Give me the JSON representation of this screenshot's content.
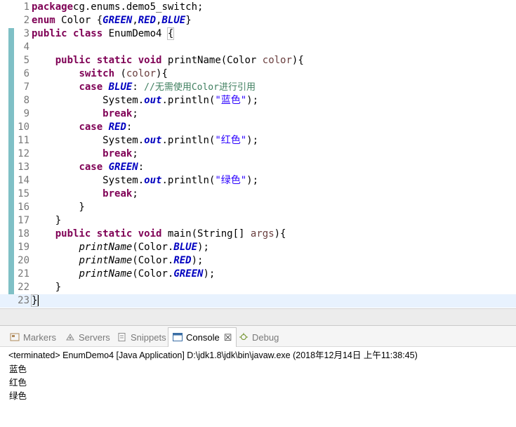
{
  "editor": {
    "lines": [
      {
        "n": "1",
        "segs": [
          [
            "kw",
            "package"
          ],
          [
            "",
            "cg.enums.demo5_switch;"
          ]
        ]
      },
      {
        "n": "2",
        "segs": [
          [
            "kw",
            "enum"
          ],
          [
            "",
            " Color {"
          ],
          [
            "en",
            "GREEN"
          ],
          [
            "",
            ","
          ],
          [
            "en",
            "RED"
          ],
          [
            "",
            ","
          ],
          [
            "en",
            "BLUE"
          ],
          [
            "",
            "}"
          ]
        ]
      },
      {
        "n": "3",
        "segs": [
          [
            "kw",
            "public"
          ],
          [
            "",
            " "
          ],
          [
            "kw",
            "class"
          ],
          [
            "",
            " EnumDemo4 "
          ],
          [
            "br",
            "{"
          ]
        ]
      },
      {
        "n": "4",
        "segs": []
      },
      {
        "n": "5",
        "segs": [
          [
            "",
            "    "
          ],
          [
            "kw",
            "public"
          ],
          [
            "",
            " "
          ],
          [
            "kw",
            "static"
          ],
          [
            "",
            " "
          ],
          [
            "kw",
            "void"
          ],
          [
            "",
            " printName(Color "
          ],
          [
            "param",
            "color"
          ],
          [
            "",
            "){"
          ]
        ]
      },
      {
        "n": "6",
        "segs": [
          [
            "",
            "        "
          ],
          [
            "kw",
            "switch"
          ],
          [
            "",
            " ("
          ],
          [
            "param",
            "color"
          ],
          [
            "",
            "){"
          ]
        ]
      },
      {
        "n": "7",
        "segs": [
          [
            "",
            "        "
          ],
          [
            "kw",
            "case"
          ],
          [
            "",
            " "
          ],
          [
            "en",
            "BLUE"
          ],
          [
            "",
            ": "
          ],
          [
            "cm",
            "//无需使用Color进行引用"
          ]
        ]
      },
      {
        "n": "8",
        "segs": [
          [
            "",
            "            System."
          ],
          [
            "fld",
            "out"
          ],
          [
            "",
            ".println("
          ],
          [
            "str",
            "\"蓝色\""
          ],
          [
            "",
            ");"
          ]
        ]
      },
      {
        "n": "9",
        "segs": [
          [
            "",
            "            "
          ],
          [
            "kw",
            "break"
          ],
          [
            "",
            ";"
          ]
        ]
      },
      {
        "n": "10",
        "segs": [
          [
            "",
            "        "
          ],
          [
            "kw",
            "case"
          ],
          [
            "",
            " "
          ],
          [
            "en",
            "RED"
          ],
          [
            "",
            ":"
          ]
        ]
      },
      {
        "n": "11",
        "segs": [
          [
            "",
            "            System."
          ],
          [
            "fld",
            "out"
          ],
          [
            "",
            ".println("
          ],
          [
            "str",
            "\"红色\""
          ],
          [
            "",
            ");"
          ]
        ]
      },
      {
        "n": "12",
        "segs": [
          [
            "",
            "            "
          ],
          [
            "kw",
            "break"
          ],
          [
            "",
            ";"
          ]
        ]
      },
      {
        "n": "13",
        "segs": [
          [
            "",
            "        "
          ],
          [
            "kw",
            "case"
          ],
          [
            "",
            " "
          ],
          [
            "en",
            "GREEN"
          ],
          [
            "",
            ":"
          ]
        ]
      },
      {
        "n": "14",
        "segs": [
          [
            "",
            "            System."
          ],
          [
            "fld",
            "out"
          ],
          [
            "",
            ".println("
          ],
          [
            "str",
            "\"绿色\""
          ],
          [
            "",
            ");"
          ]
        ]
      },
      {
        "n": "15",
        "segs": [
          [
            "",
            "            "
          ],
          [
            "kw",
            "break"
          ],
          [
            "",
            ";"
          ]
        ]
      },
      {
        "n": "16",
        "segs": [
          [
            "",
            "        }"
          ]
        ]
      },
      {
        "n": "17",
        "segs": [
          [
            "",
            "    }"
          ]
        ]
      },
      {
        "n": "18",
        "segs": [
          [
            "",
            "    "
          ],
          [
            "kw",
            "public"
          ],
          [
            "",
            " "
          ],
          [
            "kw",
            "static"
          ],
          [
            "",
            " "
          ],
          [
            "kw",
            "void"
          ],
          [
            "",
            " main(String[] "
          ],
          [
            "param",
            "args"
          ],
          [
            "",
            "){"
          ]
        ]
      },
      {
        "n": "19",
        "segs": [
          [
            "",
            "        "
          ],
          [
            "sm",
            "printName"
          ],
          [
            "",
            "(Color."
          ],
          [
            "en",
            "BLUE"
          ],
          [
            "",
            ");"
          ]
        ]
      },
      {
        "n": "20",
        "segs": [
          [
            "",
            "        "
          ],
          [
            "sm",
            "printName"
          ],
          [
            "",
            "(Color."
          ],
          [
            "en",
            "RED"
          ],
          [
            "",
            ");"
          ]
        ]
      },
      {
        "n": "21",
        "segs": [
          [
            "",
            "        "
          ],
          [
            "sm",
            "printName"
          ],
          [
            "",
            "(Color."
          ],
          [
            "en",
            "GREEN"
          ],
          [
            "",
            ");"
          ]
        ]
      },
      {
        "n": "22",
        "segs": [
          [
            "",
            "    }"
          ]
        ]
      },
      {
        "n": "23",
        "segs": [
          [
            "br",
            "}"
          ]
        ],
        "current": true
      }
    ]
  },
  "console": {
    "tabs": [
      {
        "label": "Markers",
        "icon": "markers-icon",
        "icon_color": "#b08a5a",
        "active": false
      },
      {
        "label": "Servers",
        "icon": "servers-icon",
        "icon_color": "#8a8a8a",
        "active": false
      },
      {
        "label": "Snippets",
        "icon": "snippets-icon",
        "icon_color": "#8a8a8a",
        "active": false
      },
      {
        "label": "Console",
        "icon": "console-icon",
        "icon_color": "#3a6ea5",
        "active": true,
        "close": "☒"
      },
      {
        "label": "Debug",
        "icon": "debug-icon",
        "icon_color": "#6b8e23",
        "active": false
      }
    ],
    "status": "<terminated> EnumDemo4 [Java Application] D:\\jdk1.8\\jdk\\bin\\javaw.exe (2018年12月14日 上午11:38:45)",
    "output": [
      "蓝色",
      "红色",
      "绿色"
    ]
  }
}
